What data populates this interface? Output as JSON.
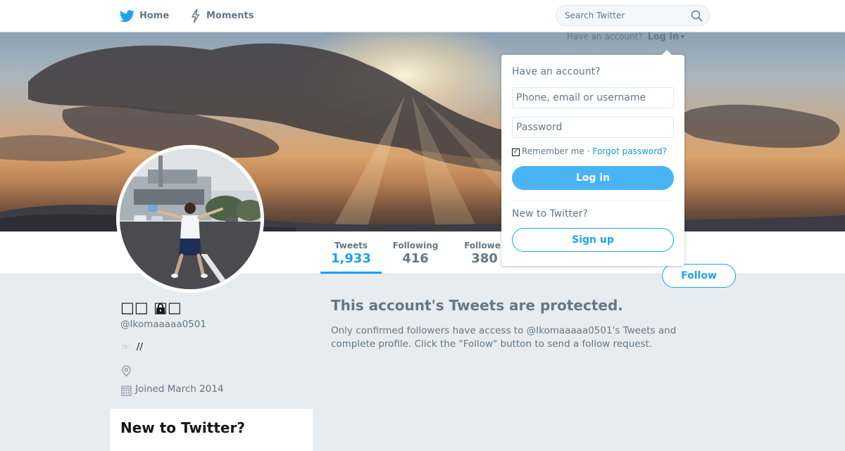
{
  "nav": {
    "home_label": "Home",
    "moments_label": "Moments",
    "search_placeholder": "Search Twitter"
  },
  "login_prompt": {
    "text": "Have an account?",
    "link": "Log in"
  },
  "login_panel": {
    "heading": "Have an account?",
    "username_placeholder": "Phone, email or username",
    "password_placeholder": "Password",
    "remember_label": "Remember me",
    "separator": "·",
    "forgot_label": "Forgot password?",
    "login_button": "Log in",
    "new_heading": "New to Twitter?",
    "signup_button": "Sign up"
  },
  "stats": [
    {
      "label": "Tweets",
      "value": "1,933"
    },
    {
      "label": "Following",
      "value": "416"
    },
    {
      "label": "Follower",
      "value": "380"
    }
  ],
  "follow_button": "Follow",
  "profile": {
    "name": "□□ □□",
    "handle": "@Ikomaaaaa0501",
    "bio": "//",
    "joined": "Joined March 2014"
  },
  "protected": {
    "title": "This account's Tweets are protected.",
    "description": "Only confirmed followers have access to @Ikomaaaaa0501's Tweets and complete profile. Click the \"Follow\" button to send a follow request."
  },
  "signup_card": {
    "title": "New to Twitter?"
  },
  "colors": {
    "brand_blue": "#1da1f2",
    "background": "#e6ecf0",
    "muted_text": "#657786"
  }
}
